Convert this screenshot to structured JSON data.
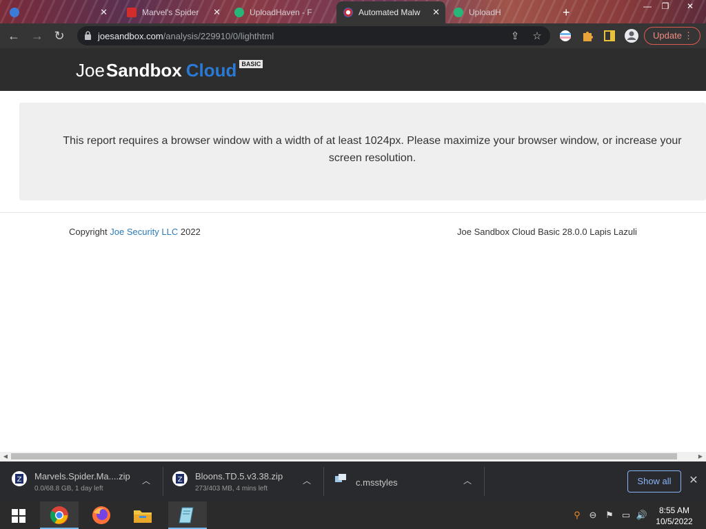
{
  "browser": {
    "tabs": [
      {
        "label": ""
      },
      {
        "label": "Marvel's Spider"
      },
      {
        "label": "UploadHaven - F"
      },
      {
        "label": "Automated Malw"
      },
      {
        "label": "UploadH"
      }
    ],
    "url_domain": "joesandbox.com",
    "url_path": "/analysis/229910/0/lighthtml",
    "update_label": "Update"
  },
  "page": {
    "logo": {
      "part1": "Joe",
      "part2": "Sandbox",
      "part3": "Cloud",
      "badge": "BASIC"
    },
    "notice_text": "This report requires a browser window with a width of at least 1024px. Please maximize your browser window, or increase your screen resolution.",
    "footer": {
      "copyright_prefix": "Copyright",
      "company_link": "Joe Security LLC",
      "year": "2022",
      "version": "Joe Sandbox Cloud Basic 28.0.0 Lapis Lazuli"
    }
  },
  "downloads": {
    "items": [
      {
        "name": "Marvels.Spider.Ma....zip",
        "status": "0.0/68.8 GB, 1 day left"
      },
      {
        "name": "Bloons.TD.5.v3.38.zip",
        "status": "273/403 MB, 4 mins left"
      },
      {
        "name": "c.msstyles",
        "status": ""
      }
    ],
    "show_all_label": "Show all"
  },
  "taskbar": {
    "time": "8:55 AM",
    "date": "10/5/2022"
  },
  "colors": {
    "link_blue": "#2b7bb9",
    "logo_blue": "#2a7ad5",
    "update_red": "#f28b82",
    "show_all_blue": "#8ab4f8"
  }
}
